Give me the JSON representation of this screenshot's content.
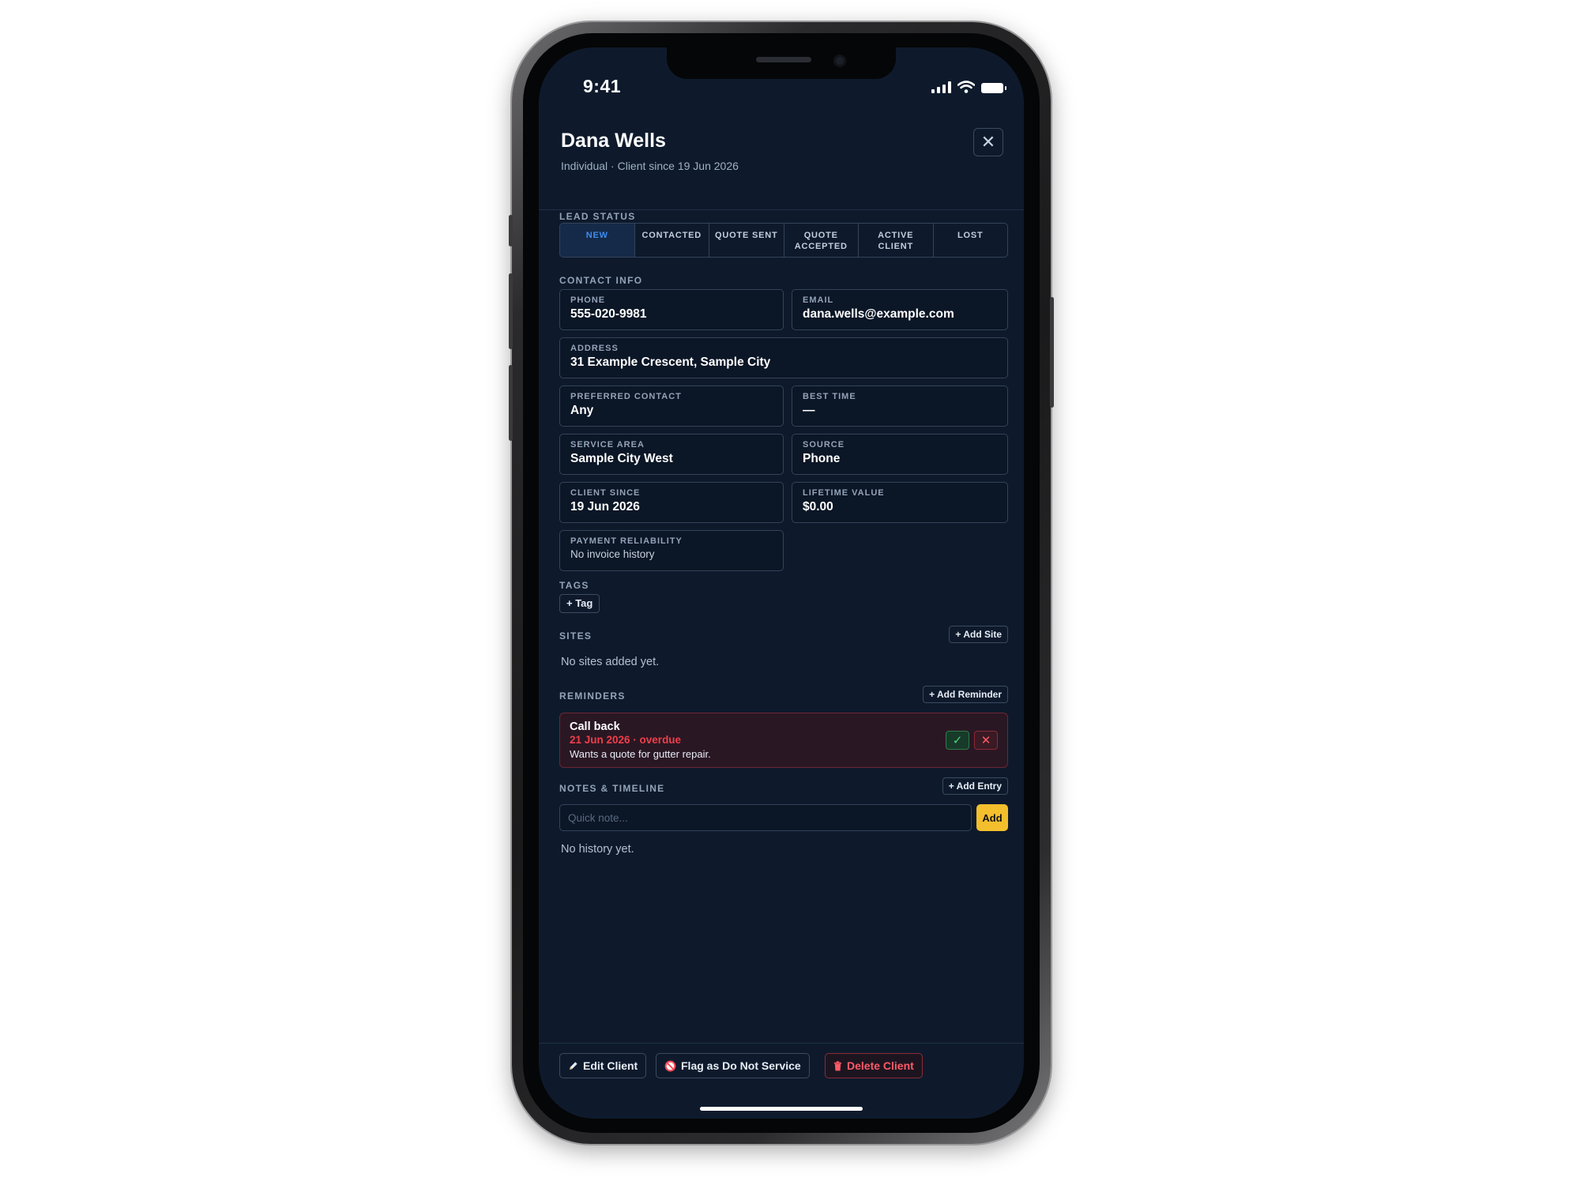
{
  "status_bar": {
    "time": "9:41"
  },
  "header": {
    "title": "Dana Wells",
    "subtitle": "Individual · Client since 19 Jun 2026",
    "close_symbol": "✕"
  },
  "lead_status": {
    "label": "LEAD STATUS",
    "options": [
      "NEW",
      "CONTACTED",
      "QUOTE SENT",
      "QUOTE ACCEPTED",
      "ACTIVE CLIENT",
      "LOST"
    ],
    "selected": "NEW",
    "options_display": [
      [
        "NEW"
      ],
      [
        "CONTACTED"
      ],
      [
        "QUOTE SENT"
      ],
      [
        "QUOTE",
        "ACCEPTED"
      ],
      [
        "ACTIVE",
        "CLIENT"
      ],
      [
        "LOST"
      ]
    ]
  },
  "contact_info": {
    "label": "CONTACT INFO",
    "phone": {
      "label": "PHONE",
      "value": "555-020-9981"
    },
    "email": {
      "label": "EMAIL",
      "value": "dana.wells@example.com"
    },
    "address": {
      "label": "ADDRESS",
      "value": "31 Example Crescent, Sample City"
    },
    "preferred_contact": {
      "label": "PREFERRED CONTACT",
      "value": "Any"
    },
    "best_time": {
      "label": "BEST TIME",
      "value": "—"
    },
    "service_area": {
      "label": "SERVICE AREA",
      "value": "Sample City West"
    },
    "source": {
      "label": "SOURCE",
      "value": "Phone"
    },
    "client_since": {
      "label": "CLIENT SINCE",
      "value": "19 Jun 2026"
    },
    "lifetime_value": {
      "label": "LIFETIME VALUE",
      "value": "$0.00"
    },
    "payment_reliability": {
      "label": "PAYMENT RELIABILITY",
      "value": "No invoice history"
    }
  },
  "tags": {
    "label": "TAGS",
    "add_label": "+ Tag"
  },
  "sites": {
    "label": "SITES",
    "add_label": "+ Add Site",
    "empty_text": "No sites added yet."
  },
  "reminders": {
    "label": "REMINDERS",
    "add_label": "+ Add Reminder",
    "items": [
      {
        "title": "Call back",
        "date": "21 Jun 2026 · overdue",
        "description": "Wants a quote for gutter repair.",
        "done_symbol": "✓",
        "delete_symbol": "✕"
      }
    ]
  },
  "notes": {
    "label": "NOTES & TIMELINE",
    "add_entry_label": "+ Add Entry",
    "input_placeholder": "Quick note...",
    "input_value": "",
    "add_label": "Add",
    "empty_text": "No history yet."
  },
  "footer": {
    "edit_label": "Edit Client",
    "flag_label": "Flag as Do Not Service",
    "delete_label": "Delete Client",
    "edit_icon": "pencil-icon",
    "flag_icon": "prohibited-icon",
    "delete_icon": "trash-icon"
  },
  "colors": {
    "background": "#0e1a2c",
    "accent_blue": "#3d8cf0",
    "danger": "#ef3f4a",
    "success": "#4fd37a",
    "primary_yellow": "#f3bf2c"
  }
}
